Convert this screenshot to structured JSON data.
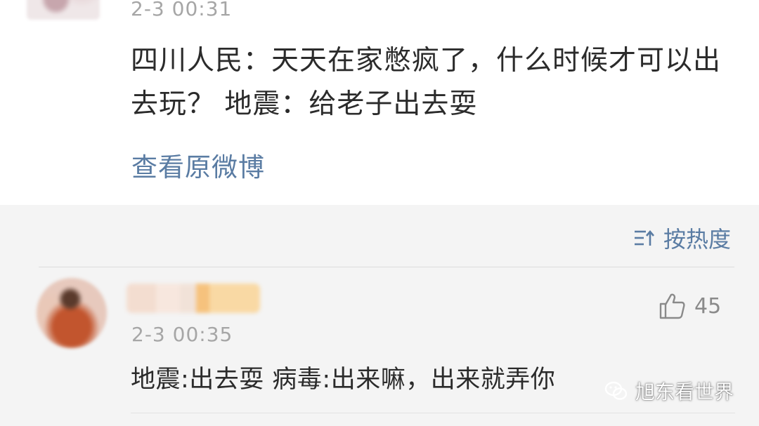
{
  "post": {
    "timestamp": "2-3 00:31",
    "text": "四川人民：天天在家憋疯了，什么时候才可以出去玩？ 地震：给老子出去耍",
    "view_original_label": "查看原微博"
  },
  "comments_section": {
    "sort_label": "按热度",
    "comment": {
      "timestamp": "2-3 00:35",
      "like_count": "45",
      "text": "地震:出去耍  病毒:出来嘛，出来就弄你"
    }
  },
  "watermark": {
    "text": "旭东看世界"
  },
  "colors": {
    "link": "#5a7ca3",
    "meta": "#a6a6a6",
    "text": "#2b2b2b",
    "section_bg": "#f4f4f4"
  },
  "icons": {
    "sort": "sort-icon",
    "like": "thumbs-up-icon",
    "watermark": "wechat-icon"
  }
}
